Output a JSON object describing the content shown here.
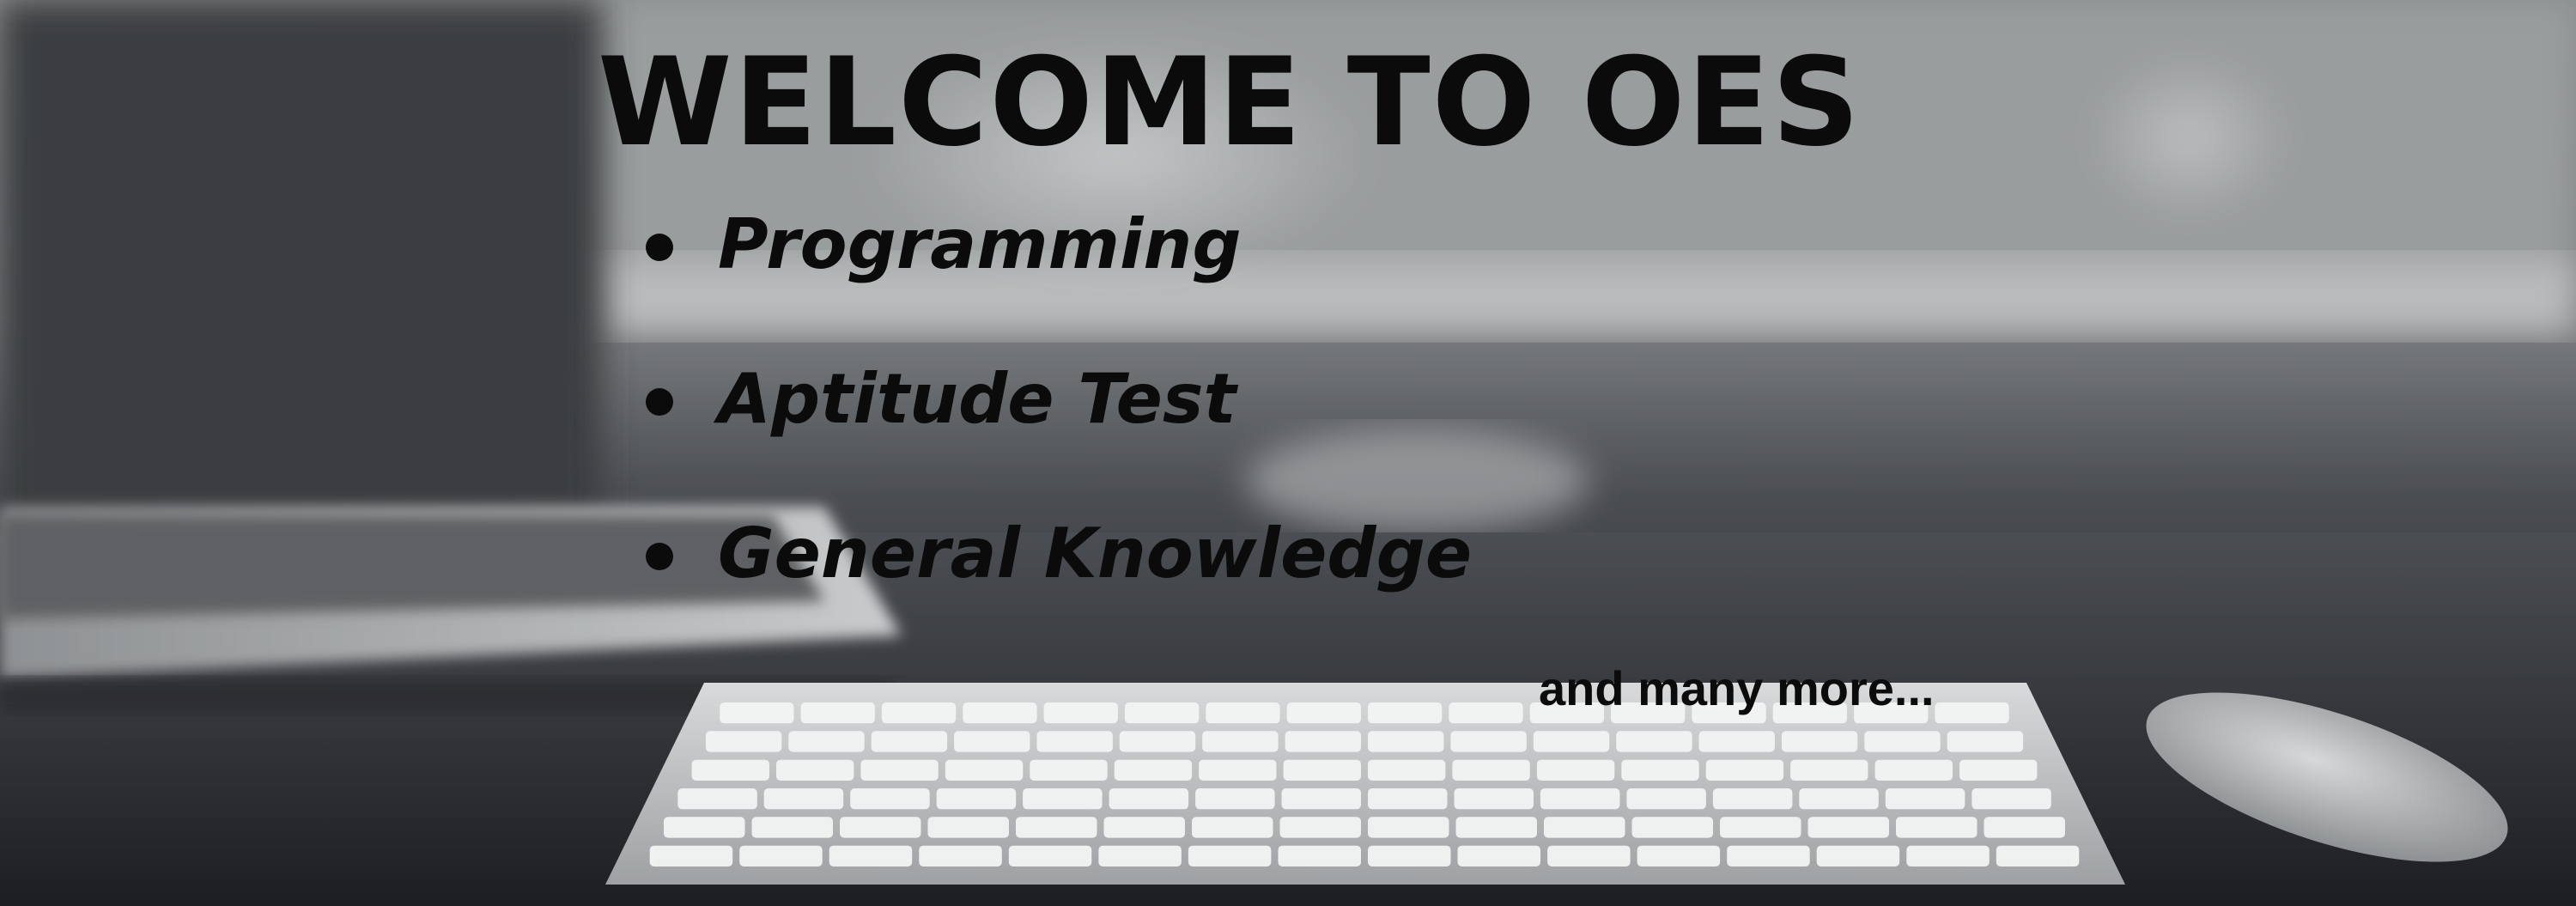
{
  "banner": {
    "headline": "WELCOME TO OES",
    "topics": [
      {
        "label": "Programming"
      },
      {
        "label": "Aptitude Test"
      },
      {
        "label": "General Knowledge"
      }
    ],
    "tagline": "and many more...",
    "colors": {
      "text": "#0b0b0b",
      "photo_tone": "grayscale"
    }
  }
}
